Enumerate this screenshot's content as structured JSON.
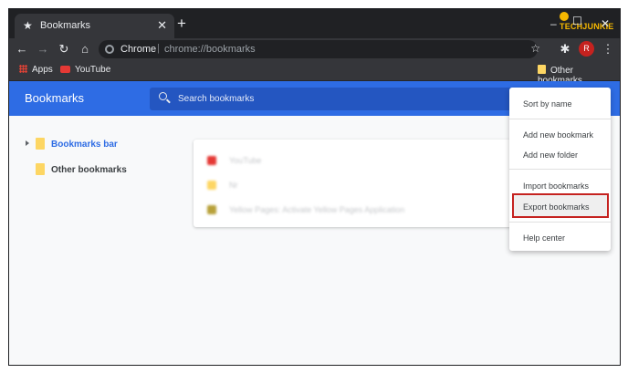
{
  "tab": {
    "title": "Bookmarks"
  },
  "watermark": {
    "text": "TECHJUNKIE"
  },
  "omnibox": {
    "site_label": "Chrome",
    "separator": "|",
    "url": "chrome://bookmarks"
  },
  "profile": {
    "initial": "R"
  },
  "bookmarks_bar": {
    "items": [
      {
        "label": "Apps",
        "icon": "apps-grid-icon"
      },
      {
        "label": "YouTube",
        "icon": "youtube-icon"
      }
    ],
    "other": {
      "label": "Other bookmarks",
      "icon": "folder-icon"
    }
  },
  "header": {
    "title": "Bookmarks",
    "search_placeholder": "Search bookmarks"
  },
  "tree": [
    {
      "label": "Bookmarks bar",
      "color": "#1a73e8",
      "expandable": true
    },
    {
      "label": "Other bookmarks",
      "color": "#3c4043",
      "expandable": false
    }
  ],
  "list": [
    {
      "label": "YouTube",
      "icon_color": "#e53935"
    },
    {
      "label": "Nr",
      "icon_color": "#fdd663"
    },
    {
      "label": "Yellow Pages: Activate Yellow Pages Application",
      "icon_color": "#b8a13a"
    }
  ],
  "menu": {
    "items": [
      {
        "label": "Sort by name"
      },
      {
        "label": "Add new bookmark"
      },
      {
        "label": "Add new folder"
      },
      {
        "label": "Import bookmarks"
      },
      {
        "label": "Export bookmarks",
        "highlighted": true
      },
      {
        "label": "Help center"
      }
    ]
  },
  "colors": {
    "accent": "#2e6ce4",
    "highlight_border": "#c5221f",
    "folder": "#fdd663"
  }
}
